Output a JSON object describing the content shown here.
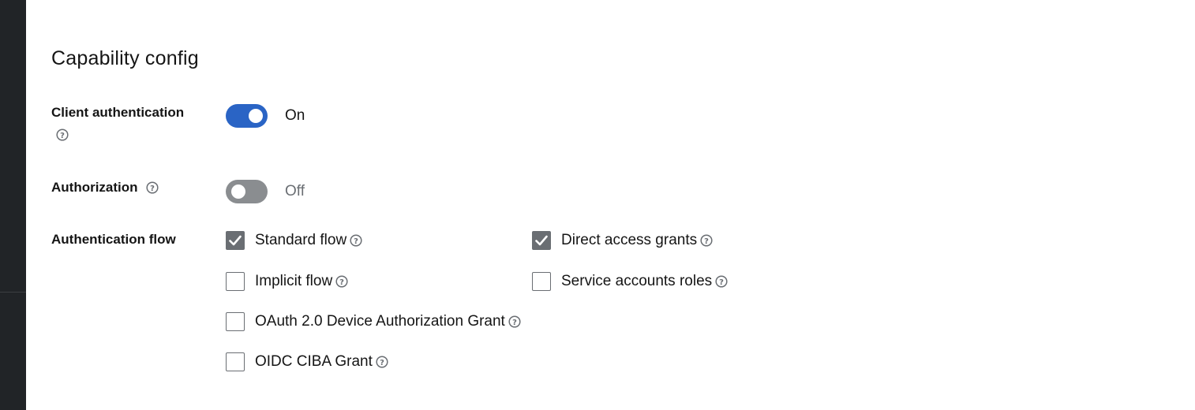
{
  "section": {
    "title": "Capability config"
  },
  "client_authentication": {
    "label": "Client authentication",
    "state_text": "On",
    "enabled": true
  },
  "authorization": {
    "label": "Authorization",
    "state_text": "Off",
    "enabled": false
  },
  "authentication_flow": {
    "label": "Authentication flow",
    "options": [
      {
        "label": "Standard flow",
        "checked": true
      },
      {
        "label": "Direct access grants",
        "checked": true
      },
      {
        "label": "Implicit flow",
        "checked": false
      },
      {
        "label": "Service accounts roles",
        "checked": false
      },
      {
        "label": "OAuth 2.0 Device Authorization Grant",
        "checked": false
      },
      {
        "label": "OIDC CIBA Grant",
        "checked": false
      }
    ]
  },
  "colors": {
    "toggle_on": "#2a64c5",
    "toggle_off": "#8a8d90",
    "checkbox_checked": "#6a6e73",
    "sidebar": "#212427"
  },
  "icons": {
    "help": "question-circle-icon",
    "check": "checkmark-icon"
  }
}
